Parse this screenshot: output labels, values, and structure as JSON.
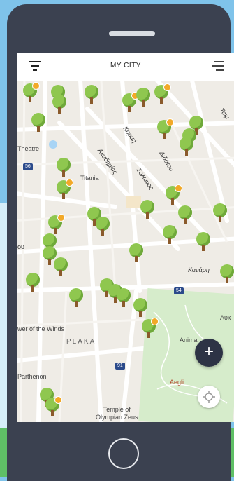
{
  "header": {
    "title": "MY CITY"
  },
  "map": {
    "places": {
      "theatre": "Theatre",
      "titania": "Titania",
      "tower": "wer of the Winds",
      "parthenon": "Parthenon",
      "temple": "Temple of\nOlympian Zeus",
      "animal": "Animal",
      "aegli": "Aegli",
      "plaka": "PLAKA",
      "lyk": "Λυκ"
    },
    "streets": {
      "akadimias": "Ακαδημίας",
      "korai": "Κοραή",
      "solonos": "Σόλωνος",
      "didotou": "Διδότου",
      "kanari": "Κανάρη",
      "tsimiski": "Τσιμ",
      "ou": "ου"
    },
    "road_badges": {
      "b56": "56",
      "b54": "54",
      "b91": "91"
    }
  },
  "fab": {
    "icon": "plus-icon",
    "label": "+"
  },
  "colors": {
    "accent": "#2d3345",
    "tree": "#8fc74f",
    "marker": "#f2a928",
    "phone": "#3b4150"
  }
}
